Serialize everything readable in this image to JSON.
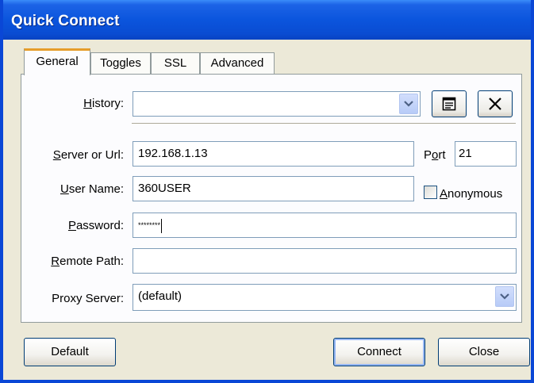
{
  "window": {
    "title": "Quick Connect"
  },
  "tabs": [
    {
      "label": "General",
      "active": true
    },
    {
      "label": "Toggles",
      "active": false
    },
    {
      "label": "SSL",
      "active": false
    },
    {
      "label": "Advanced",
      "active": false
    }
  ],
  "history": {
    "label_mnemonic": "H",
    "label_rest": "istory:",
    "value": ""
  },
  "server": {
    "label_mnemonic": "S",
    "label_rest": "erver or Url:",
    "value": "192.168.1.13"
  },
  "port": {
    "label_pre": "P",
    "label_mnemonic": "o",
    "label_rest": "rt",
    "value": "21"
  },
  "username": {
    "label_mnemonic": "U",
    "label_rest": "ser Name:",
    "value": "360USER"
  },
  "anonymous": {
    "label_mnemonic": "A",
    "label_rest": "nonymous",
    "checked": false
  },
  "password": {
    "label_mnemonic": "P",
    "label_rest": "assword:",
    "value": "********"
  },
  "remote_path": {
    "label_mnemonic": "R",
    "label_rest": "emote Path:",
    "value": ""
  },
  "proxy": {
    "label": "Proxy Server:",
    "value": "(default)"
  },
  "buttons": {
    "default": "Default",
    "connect": "Connect",
    "close": "Close"
  },
  "colors": {
    "title_bar": "#0a4cd2",
    "dialog_bg": "#ece9d8",
    "tab_highlight": "#e69d2a",
    "field_border": "#7f9db9"
  }
}
